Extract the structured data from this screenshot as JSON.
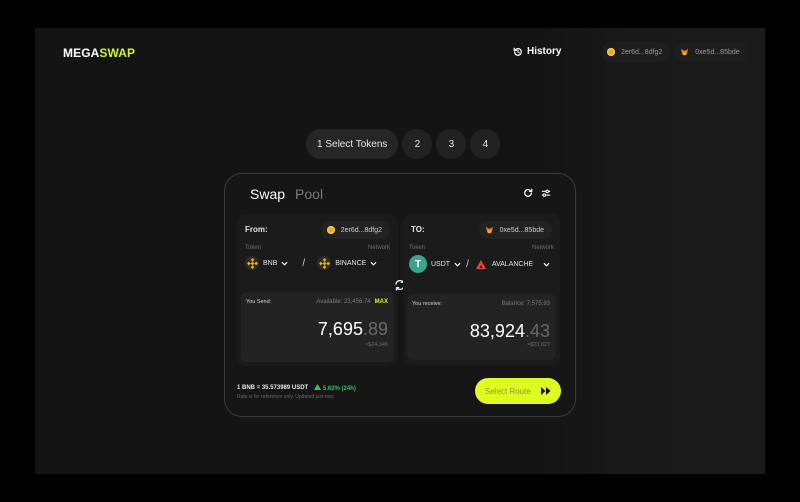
{
  "brand": {
    "mega": "MEGA",
    "swap": "SWAP",
    "accent": "#d4f32a"
  },
  "header": {
    "history_label": "History",
    "wallets": [
      {
        "address": "2er6d...8dfg2",
        "icon": "coin-icon"
      },
      {
        "address": "0xe5d...85bde",
        "icon": "metamask-fox-icon"
      }
    ]
  },
  "steps": [
    "1 Select Tokens",
    "2",
    "3",
    "4"
  ],
  "card": {
    "tabs": {
      "swap": "Swap",
      "pool": "Pool"
    },
    "from": {
      "title": "From:",
      "address": "2er6d...8dfg2",
      "token_label": "Token",
      "network_label": "Network",
      "token": "BNB",
      "network": "BINANCE",
      "send_label": "You Send:",
      "available": "Available: 23,456.74",
      "max": "MAX",
      "amount_int": "7,695",
      "amount_dec": ".89",
      "usd": "≈$24,345"
    },
    "to": {
      "title": "TO:",
      "address": "0xe5d...85bde",
      "token_label": "Token",
      "network_label": "Network",
      "token": "USDT",
      "network": "AVALANCHE",
      "receive_label": "You receive:",
      "balance": "Balance: 7,575.93",
      "amount_int": "83,924",
      "amount_dec": ".43",
      "usd": "≈$23,827"
    },
    "rate": {
      "text": "1 BNB = 35.573989 USDT",
      "change": "5.62% (24h)",
      "note": "Rate is for reference only. Updated just now"
    },
    "route_button": "Select Route"
  }
}
